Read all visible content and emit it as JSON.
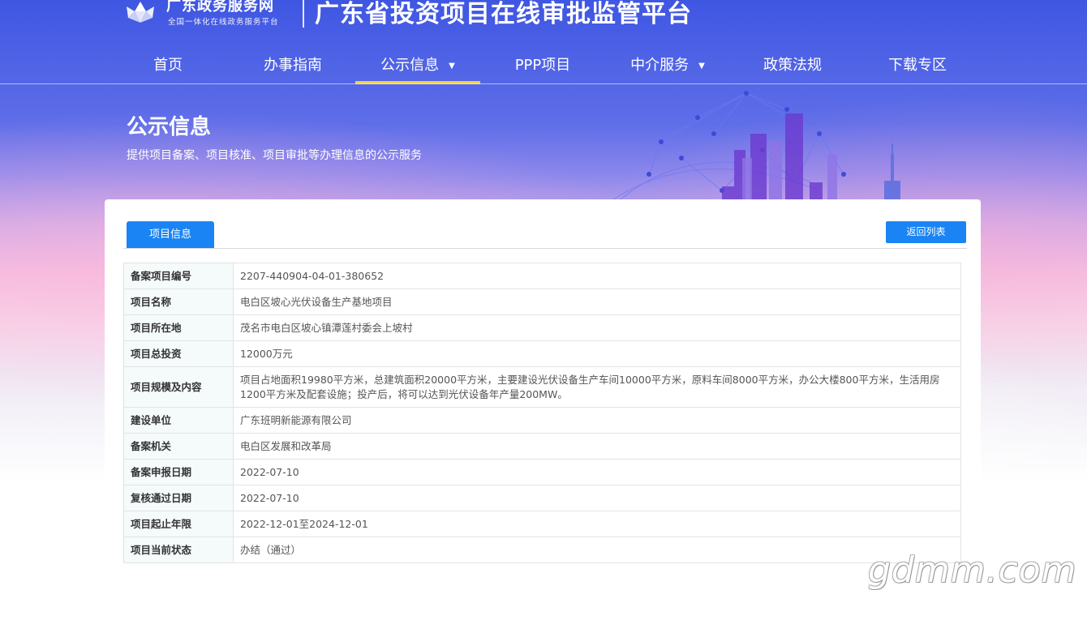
{
  "header": {
    "logo_name": "广东政务服务网",
    "logo_subtitle": "全国一体化在线政务服务平台",
    "platform_title": "广东省投资项目在线审批监管平台"
  },
  "nav": {
    "items": [
      {
        "label": "首页",
        "has_dropdown": false,
        "active": false
      },
      {
        "label": "办事指南",
        "has_dropdown": false,
        "active": false
      },
      {
        "label": "公示信息",
        "has_dropdown": true,
        "active": true
      },
      {
        "label": "PPP项目",
        "has_dropdown": false,
        "active": false
      },
      {
        "label": "中介服务",
        "has_dropdown": true,
        "active": false
      },
      {
        "label": "政策法规",
        "has_dropdown": false,
        "active": false
      },
      {
        "label": "下载专区",
        "has_dropdown": false,
        "active": false
      }
    ]
  },
  "banner": {
    "title": "公示信息",
    "subtitle": "提供项目备案、项目核准、项目审批等办理信息的公示服务"
  },
  "content": {
    "tab_label": "项目信息",
    "back_button_label": "返回列表",
    "rows": [
      {
        "label": "备案项目编号",
        "value": "2207-440904-04-01-380652"
      },
      {
        "label": "项目名称",
        "value": "电白区坡心光伏设备生产基地项目"
      },
      {
        "label": "项目所在地",
        "value": "茂名市电白区坡心镇潭莲村委会上坡村"
      },
      {
        "label": "项目总投资",
        "value": "12000万元"
      },
      {
        "label": "项目规模及内容",
        "value": "项目占地面积19980平方米，总建筑面积20000平方米，主要建设光伏设备生产车间10000平方米，原料车间8000平方米，办公大楼800平方米，生活用房1200平方米及配套设施；投产后，将可以达到光伏设备年产量200MW。"
      },
      {
        "label": "建设单位",
        "value": "广东班明新能源有限公司"
      },
      {
        "label": "备案机关",
        "value": "电白区发展和改革局"
      },
      {
        "label": "备案申报日期",
        "value": "2022-07-10"
      },
      {
        "label": "复核通过日期",
        "value": "2022-07-10"
      },
      {
        "label": "项目起止年限",
        "value": "2022-12-01至2024-12-01"
      },
      {
        "label": "项目当前状态",
        "value": "办结（通过）"
      }
    ]
  },
  "watermark": "gdmm.com",
  "colors": {
    "accent_blue": "#1a84f4",
    "nav_active_underline": "#f1d23b",
    "label_cell_bg": "#f5fafa"
  }
}
